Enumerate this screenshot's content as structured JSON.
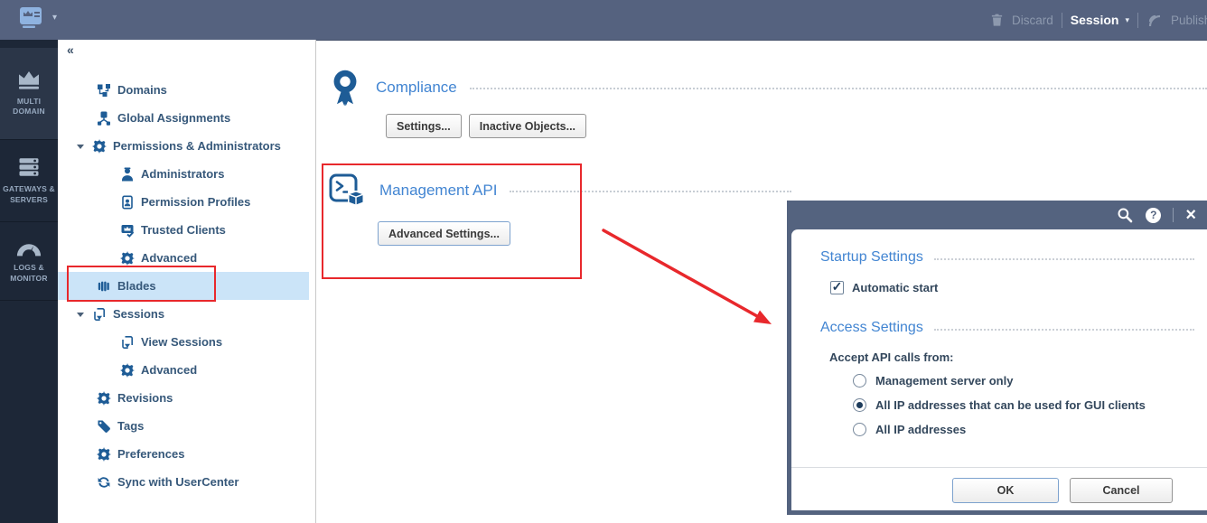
{
  "topbar": {
    "discard_label": "Discard",
    "session_label": "Session",
    "publish_label": "Publish"
  },
  "sidebar": {
    "items": [
      {
        "label": "MULTI DOMAIN",
        "icon": "crown-icon",
        "active": true
      },
      {
        "label": "GATEWAYS & SERVERS",
        "icon": "servers-icon",
        "active": false
      },
      {
        "label": "LOGS & MONITOR",
        "icon": "gauge-icon",
        "active": false
      }
    ]
  },
  "tree": {
    "collapse_glyph": "«",
    "items": [
      {
        "label": "Domains",
        "icon": "domains-icon"
      },
      {
        "label": "Global Assignments",
        "icon": "assignments-icon"
      },
      {
        "label": "Permissions & Administrators",
        "icon": "gear-icon",
        "expanded": true
      },
      {
        "label": "Administrators",
        "icon": "person-icon"
      },
      {
        "label": "Permission Profiles",
        "icon": "profile-card-icon"
      },
      {
        "label": "Trusted Clients",
        "icon": "trusted-client-icon"
      },
      {
        "label": "Advanced",
        "icon": "gear-icon"
      },
      {
        "label": "Blades",
        "icon": "blades-icon",
        "selected": true,
        "annotated": true
      },
      {
        "label": "Sessions",
        "icon": "session-icon",
        "expanded": true
      },
      {
        "label": "View Sessions",
        "icon": "session-icon"
      },
      {
        "label": "Advanced",
        "icon": "gear-icon"
      },
      {
        "label": "Revisions",
        "icon": "gear-icon"
      },
      {
        "label": "Tags",
        "icon": "tag-icon"
      },
      {
        "label": "Preferences",
        "icon": "gear-icon"
      },
      {
        "label": "Sync with UserCenter",
        "icon": "sync-icon"
      }
    ]
  },
  "main": {
    "compliance": {
      "title": "Compliance",
      "settings_button": "Settings...",
      "inactive_objects_button": "Inactive Objects..."
    },
    "management_api": {
      "title": "Management API",
      "advanced_settings_button": "Advanced Settings..."
    }
  },
  "dialog": {
    "startup_heading": "Startup Settings",
    "automatic_start_label": "Automatic start",
    "automatic_start_checked": true,
    "access_heading": "Access Settings",
    "accept_label": "Accept API calls from:",
    "radio_options": [
      {
        "label": "Management server only",
        "selected": false
      },
      {
        "label": "All IP addresses that can be used for GUI clients",
        "selected": true
      },
      {
        "label": "All IP addresses",
        "selected": false
      }
    ],
    "ok_button": "OK",
    "cancel_button": "Cancel"
  },
  "colors": {
    "topbar_bg": "#55627F",
    "sidebar_bg": "#1D2737",
    "sidebar_active_bg": "#2B3648",
    "tree_text": "#36587A",
    "icon_blue": "#1E5C96",
    "heading_blue": "#4285D2",
    "selected_row_bg": "#CBE4F8",
    "annotation_red": "#E8282C",
    "dialog_frame": "#54637F",
    "focus_border": "#7DA2CE"
  }
}
